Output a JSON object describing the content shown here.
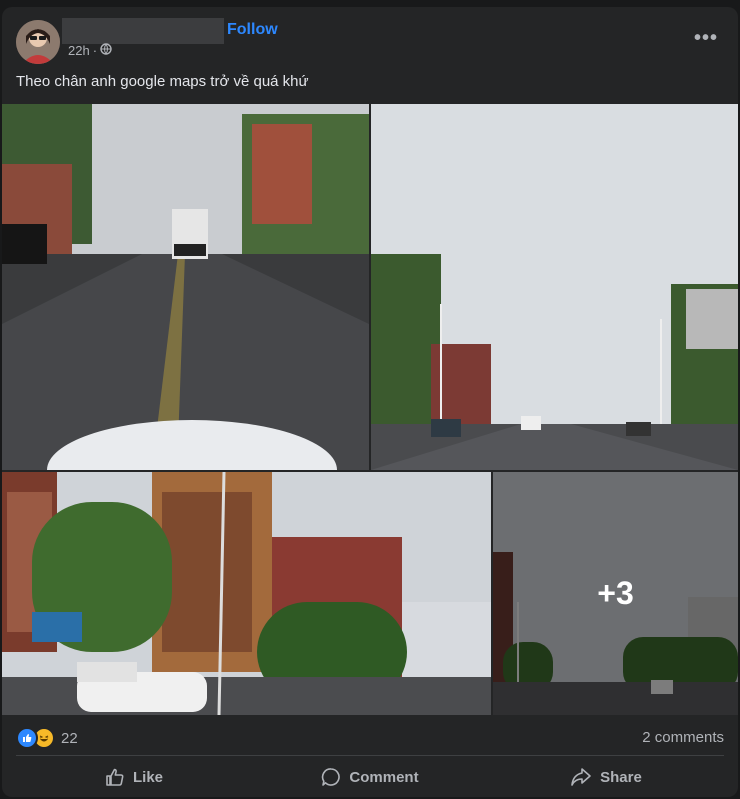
{
  "post": {
    "author_name": "",
    "follow_label": "Follow",
    "time": "22h",
    "separator": "·",
    "privacy_icon": "globe-icon",
    "more_icon": "more-options-icon",
    "more_label": "•••",
    "text": "Theo chân anh google maps trở  về quá khứ",
    "photos": [
      {
        "kind": "street-view",
        "label": "street photo 1"
      },
      {
        "kind": "street-view",
        "label": "street photo 2"
      },
      {
        "kind": "street-view",
        "label": "street photo 3"
      },
      {
        "kind": "street-view",
        "label": "street photo 4"
      }
    ],
    "more_photos": "+3"
  },
  "reactions": {
    "icons": [
      "like-reaction-icon",
      "haha-reaction-icon"
    ],
    "count": "22",
    "comments": "2 comments"
  },
  "actions": {
    "like": "Like",
    "comment": "Comment",
    "share": "Share"
  },
  "colors": {
    "background": "#18191a",
    "card": "#242526",
    "accent": "#2d88ff",
    "text": "#e4e6eb",
    "secondary_text": "#b0b3b8"
  }
}
